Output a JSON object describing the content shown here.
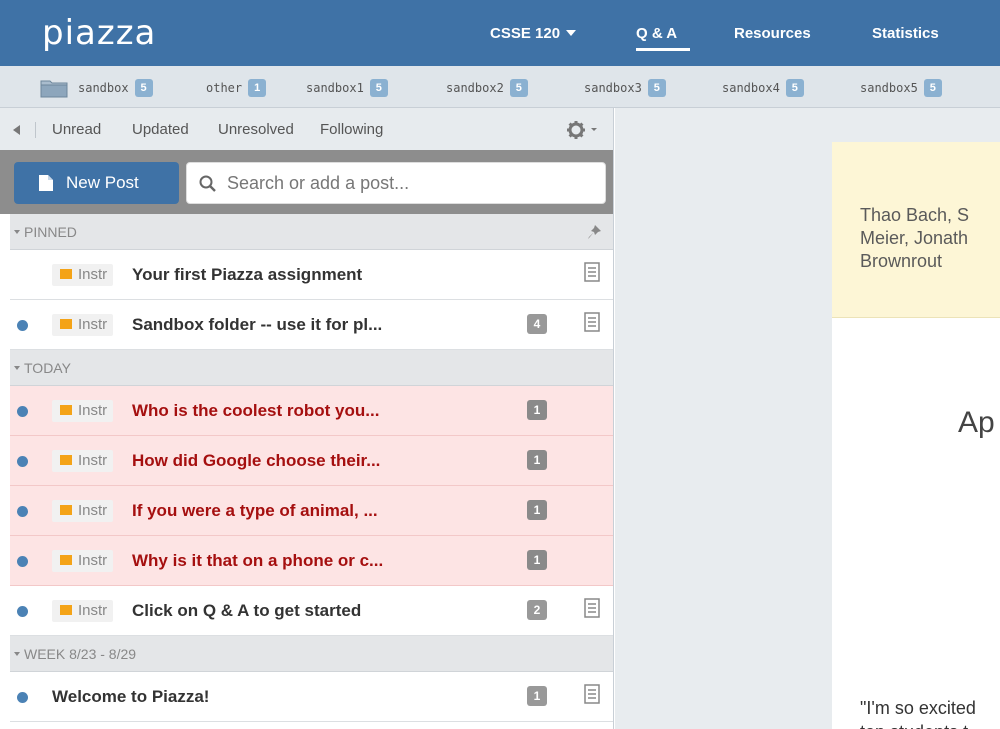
{
  "app": {
    "logo_text": "piazza"
  },
  "nav": {
    "course": "CSSE 120",
    "items": [
      "Q & A",
      "Resources",
      "Statistics"
    ]
  },
  "folders": [
    {
      "label": "sandbox",
      "count": "5"
    },
    {
      "label": "other",
      "count": "1"
    },
    {
      "label": "sandbox1",
      "count": "5"
    },
    {
      "label": "sandbox2",
      "count": "5"
    },
    {
      "label": "sandbox3",
      "count": "5"
    },
    {
      "label": "sandbox4",
      "count": "5"
    },
    {
      "label": "sandbox5",
      "count": "5"
    }
  ],
  "filters": [
    "Unread",
    "Updated",
    "Unresolved",
    "Following"
  ],
  "toolbar": {
    "new_post_label": "New Post",
    "search_placeholder": "Search or add a post..."
  },
  "sections": {
    "pinned": "PINNED",
    "today": "TODAY",
    "week": "WEEK 8/23 - 8/29"
  },
  "posts": {
    "pinned": [
      {
        "tag": "Instr",
        "title": "Your first Piazza assignment",
        "count": ""
      },
      {
        "tag": "Instr",
        "title": "Sandbox folder -- use it for pl...",
        "count": "4"
      }
    ],
    "today": [
      {
        "tag": "Instr",
        "title": "Who is the coolest robot you...",
        "count": "1"
      },
      {
        "tag": "Instr",
        "title": "How did Google choose their...",
        "count": "1"
      },
      {
        "tag": "Instr",
        "title": "If you were a type of animal, ...",
        "count": "1"
      },
      {
        "tag": "Instr",
        "title": "Why is it that on a phone or c...",
        "count": "1"
      },
      {
        "tag": "Instr",
        "title": "Click on Q & A to get started",
        "count": "2"
      }
    ],
    "week": [
      {
        "tag": "",
        "title": "Welcome to Piazza!",
        "count": "1"
      }
    ]
  },
  "right_panel": {
    "names_lines": [
      "Thao Bach, S",
      "Meier, Jonath",
      "Brownrout"
    ],
    "heading": "Ap",
    "quote_lines": [
      "\"I'm so excited",
      "top students t"
    ]
  },
  "colors": {
    "brand": "#3f72a6",
    "unread_bg": "#fde4e4",
    "unread_text": "#a50f0f",
    "dot": "#4b82b5",
    "tag_square": "#f4a317",
    "folder_badge": "#8bb1d1",
    "card_yellow": "#fdf6d6"
  }
}
